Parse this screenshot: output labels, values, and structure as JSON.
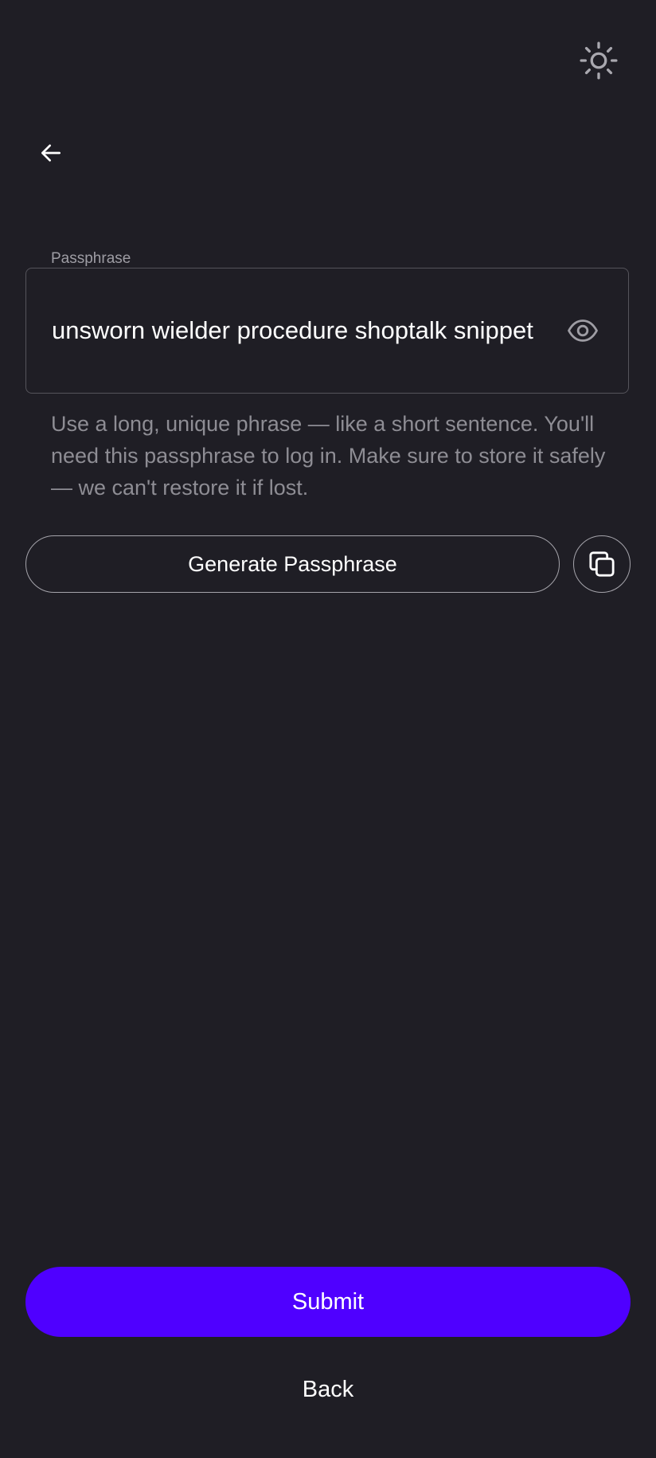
{
  "header": {
    "theme_icon": "sun-icon",
    "back_icon": "arrow-left-icon"
  },
  "passphrase_field": {
    "label": "Passphrase",
    "value": "unsworn wielder procedure shoptalk snippet",
    "visibility_icon": "eye-icon"
  },
  "helper_text": "Use a long, unique phrase — like a short sentence. You'll need this passphrase to log in. Make sure to store it safely — we can't restore it if lost.",
  "actions": {
    "generate_label": "Generate Passphrase",
    "copy_icon": "copy-icon",
    "submit_label": "Submit",
    "back_label": "Back"
  },
  "colors": {
    "background": "#1f1e25",
    "accent": "#4f00ff",
    "text": "#ffffff",
    "muted_text": "#8e8d94"
  }
}
